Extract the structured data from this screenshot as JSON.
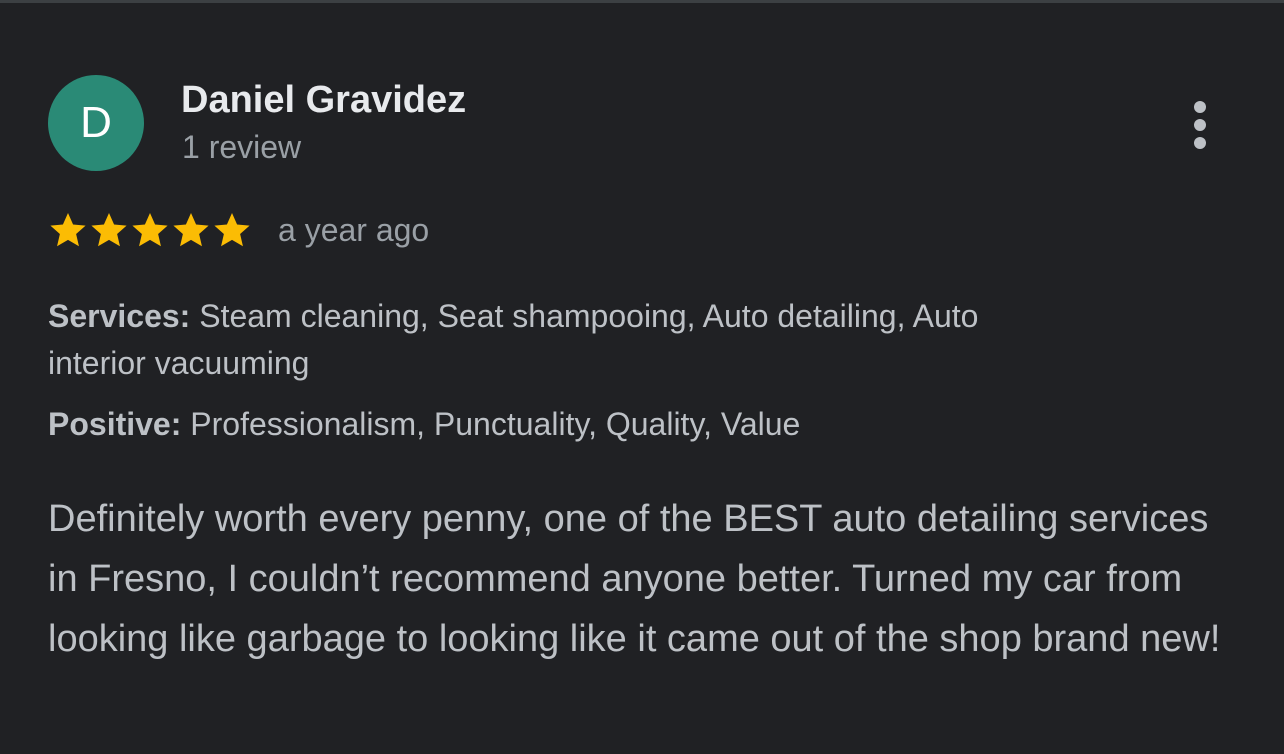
{
  "review": {
    "reviewer": {
      "avatar_initial": "D",
      "avatar_color": "#2a8a76",
      "name": "Daniel Gravidez",
      "meta": "1 review"
    },
    "more_options_icon": "more-vert-icon",
    "rating": {
      "stars": 5,
      "max_stars": 5,
      "star_color": "#fbbc04",
      "time_ago": "a year ago"
    },
    "services": {
      "label": "Services:",
      "value": "Steam cleaning, Seat shampooing, Auto detailing, Auto interior vacuuming"
    },
    "positive": {
      "label": "Positive:",
      "value": "Professionalism, Punctuality, Quality, Value"
    },
    "text": "Definitely worth every penny, one of the BEST auto detailing services in Fresno, I couldn’t recommend anyone better. Turned my car from looking like garbage to looking like it came out of the shop brand new!"
  }
}
